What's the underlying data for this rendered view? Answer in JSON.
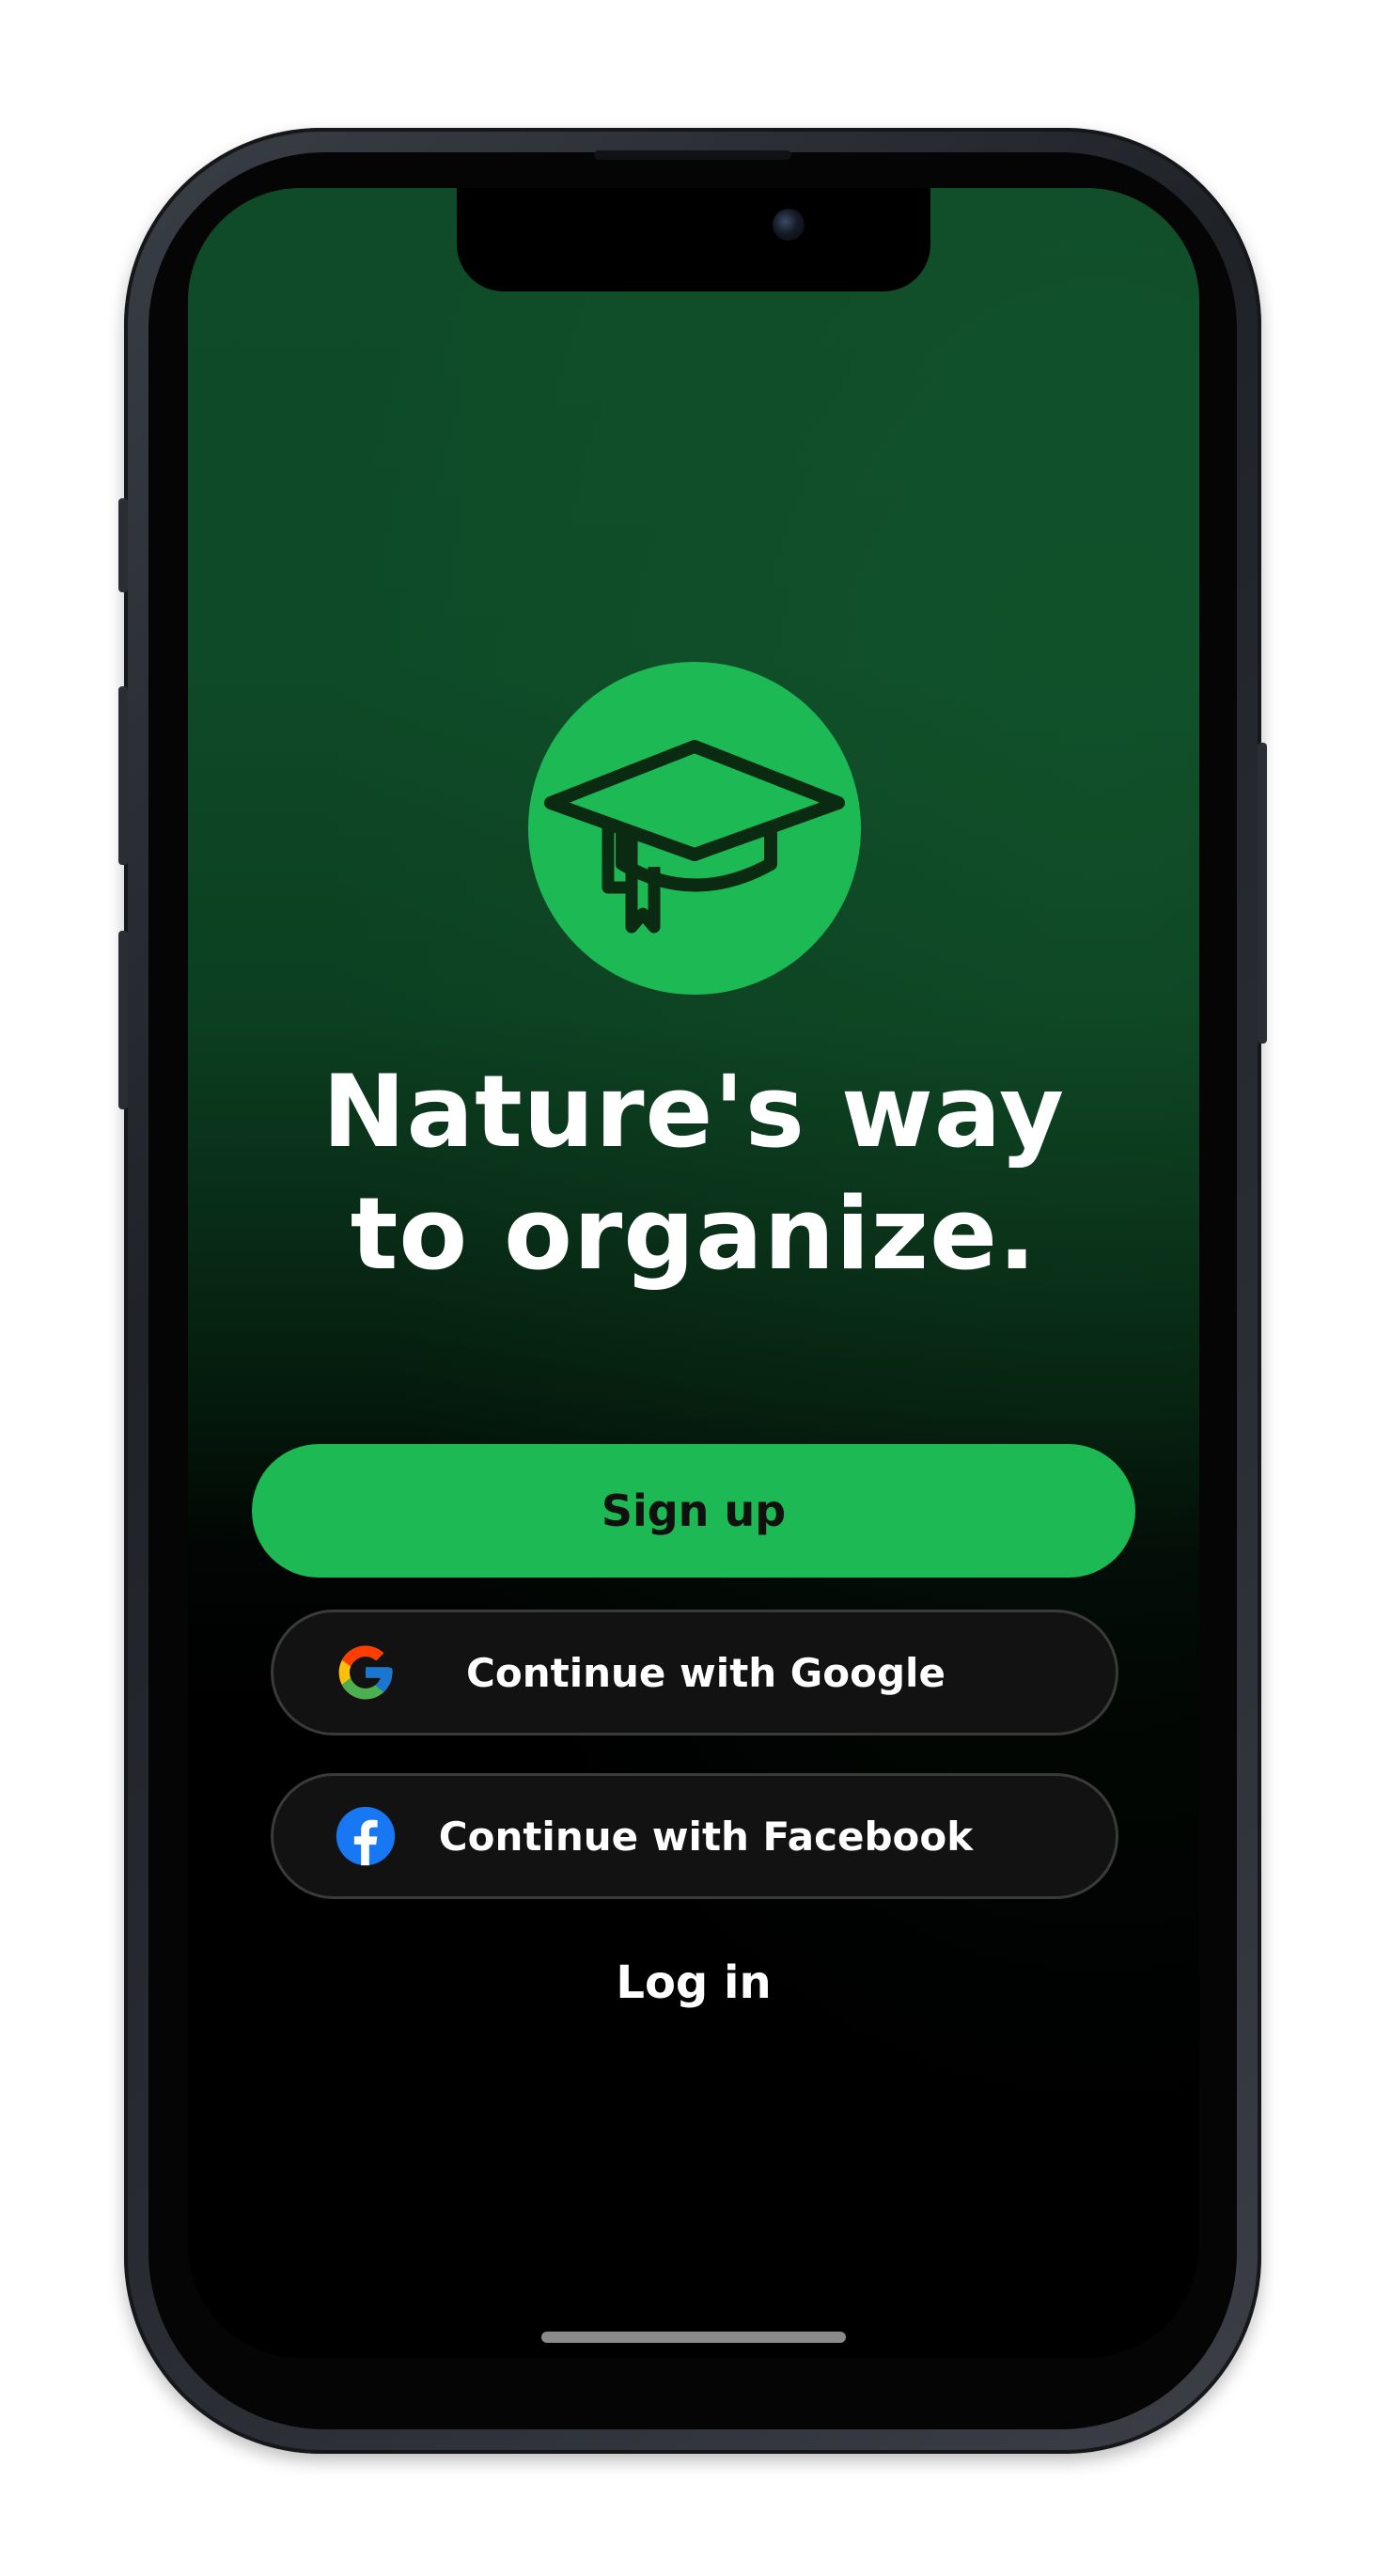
{
  "headline": {
    "line1": "Nature's way",
    "line2": "to organize."
  },
  "buttons": {
    "signup": "Sign up",
    "google": "Continue with Google",
    "facebook": "Continue with Facebook",
    "login": "Log in"
  },
  "icons": {
    "logo": "graduation-cap-icon",
    "google": "google-icon",
    "facebook": "facebook-icon"
  },
  "colors": {
    "accent": "#1db954",
    "background_top": "#0f4b28",
    "background_bottom": "#000000",
    "button_dark": "#121212"
  }
}
